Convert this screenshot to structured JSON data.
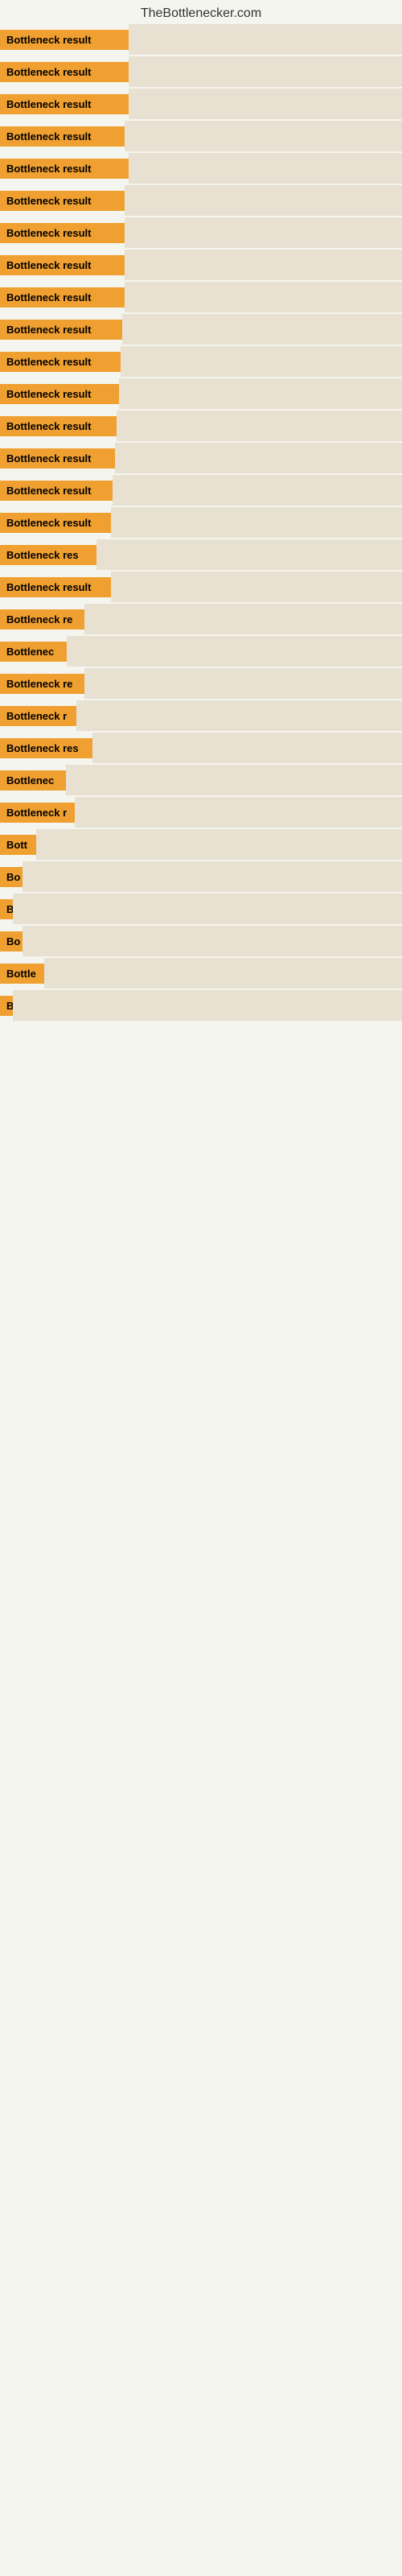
{
  "site": {
    "title": "TheBottlenecker.com"
  },
  "items": [
    {
      "label": "Bottleneck result",
      "badge_width": 160,
      "bar_visible": true
    },
    {
      "label": "Bottleneck result",
      "badge_width": 160,
      "bar_visible": true
    },
    {
      "label": "Bottleneck result",
      "badge_width": 160,
      "bar_visible": true
    },
    {
      "label": "Bottleneck result",
      "badge_width": 155,
      "bar_visible": true
    },
    {
      "label": "Bottleneck result",
      "badge_width": 160,
      "bar_visible": true
    },
    {
      "label": "Bottleneck result",
      "badge_width": 155,
      "bar_visible": true
    },
    {
      "label": "Bottleneck result",
      "badge_width": 155,
      "bar_visible": true
    },
    {
      "label": "Bottleneck result",
      "badge_width": 155,
      "bar_visible": true
    },
    {
      "label": "Bottleneck result",
      "badge_width": 155,
      "bar_visible": true
    },
    {
      "label": "Bottleneck result",
      "badge_width": 152,
      "bar_visible": true
    },
    {
      "label": "Bottleneck result",
      "badge_width": 150,
      "bar_visible": true
    },
    {
      "label": "Bottleneck result",
      "badge_width": 148,
      "bar_visible": true
    },
    {
      "label": "Bottleneck result",
      "badge_width": 145,
      "bar_visible": true
    },
    {
      "label": "Bottleneck result",
      "badge_width": 143,
      "bar_visible": true
    },
    {
      "label": "Bottleneck result",
      "badge_width": 140,
      "bar_visible": true
    },
    {
      "label": "Bottleneck result",
      "badge_width": 138,
      "bar_visible": true
    },
    {
      "label": "Bottleneck res",
      "badge_width": 120,
      "bar_visible": true
    },
    {
      "label": "Bottleneck result",
      "badge_width": 138,
      "bar_visible": true
    },
    {
      "label": "Bottleneck re",
      "badge_width": 105,
      "bar_visible": true
    },
    {
      "label": "Bottlenec",
      "badge_width": 83,
      "bar_visible": true
    },
    {
      "label": "Bottleneck re",
      "badge_width": 105,
      "bar_visible": true
    },
    {
      "label": "Bottleneck r",
      "badge_width": 95,
      "bar_visible": true
    },
    {
      "label": "Bottleneck res",
      "badge_width": 115,
      "bar_visible": true
    },
    {
      "label": "Bottlenec",
      "badge_width": 82,
      "bar_visible": true
    },
    {
      "label": "Bottleneck r",
      "badge_width": 93,
      "bar_visible": true
    },
    {
      "label": "Bott",
      "badge_width": 45,
      "bar_visible": true
    },
    {
      "label": "Bo",
      "badge_width": 28,
      "bar_visible": true
    },
    {
      "label": "B",
      "badge_width": 14,
      "bar_visible": true
    },
    {
      "label": "Bo",
      "badge_width": 28,
      "bar_visible": true
    },
    {
      "label": "Bottle",
      "badge_width": 55,
      "bar_visible": true
    },
    {
      "label": "B",
      "badge_width": 12,
      "bar_visible": true
    },
    {
      "label": "",
      "badge_width": 0,
      "bar_visible": false
    },
    {
      "label": "",
      "badge_width": 0,
      "bar_visible": false
    },
    {
      "label": "",
      "badge_width": 0,
      "bar_visible": false
    },
    {
      "label": "",
      "badge_width": 0,
      "bar_visible": false
    },
    {
      "label": "",
      "badge_width": 0,
      "bar_visible": false
    },
    {
      "label": "",
      "badge_width": 0,
      "bar_visible": false
    },
    {
      "label": "",
      "badge_width": 0,
      "bar_visible": false
    },
    {
      "label": "",
      "badge_width": 0,
      "bar_visible": false
    }
  ]
}
